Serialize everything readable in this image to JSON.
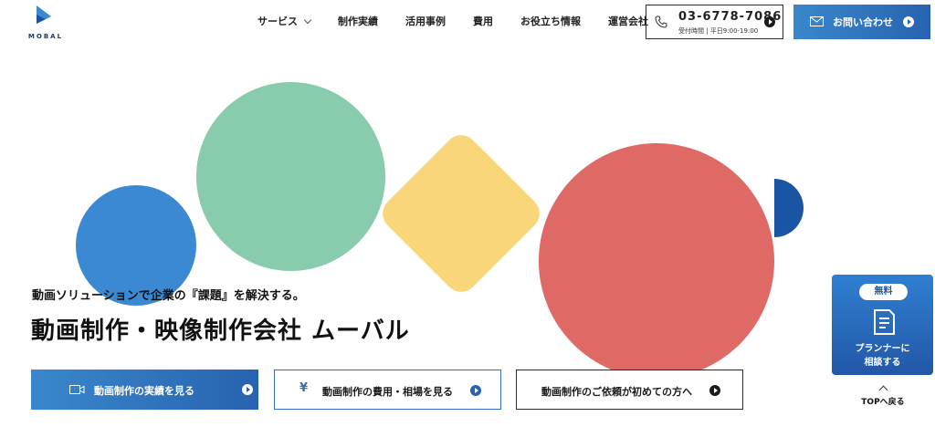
{
  "brand": {
    "logo_text": "MOBAL"
  },
  "nav": {
    "items": [
      {
        "label": "サービス",
        "has_dropdown": true
      },
      {
        "label": "制作実績"
      },
      {
        "label": "活用事例"
      },
      {
        "label": "費用"
      },
      {
        "label": "お役立ち情報"
      },
      {
        "label": "運営会社"
      }
    ]
  },
  "phone": {
    "number": "03-6778-7086",
    "hours": "受付時間 | 平日9:00-19:00"
  },
  "contact": {
    "label": "お問い合わせ"
  },
  "hero": {
    "subtitle": "動画ソリューションで企業の『課題』を解決する。",
    "title": "動画制作・映像制作会社 ムーバル"
  },
  "cta": {
    "works": "動画制作の実績を見る",
    "pricing": "動画制作の費用・相場を見る",
    "first_time": "動画制作のご依頼が初めての方へ"
  },
  "planner": {
    "badge": "無料",
    "line1": "プランナーに",
    "line2": "相談する"
  },
  "totop": {
    "label": "TOPへ戻る"
  },
  "colors": {
    "accent_blue": "#2763b0",
    "shape_blue": "#3a89d2",
    "shape_green": "#88cbad",
    "shape_yellow": "#fad67a",
    "shape_red": "#de6965",
    "shape_navy": "#1a55a3"
  }
}
